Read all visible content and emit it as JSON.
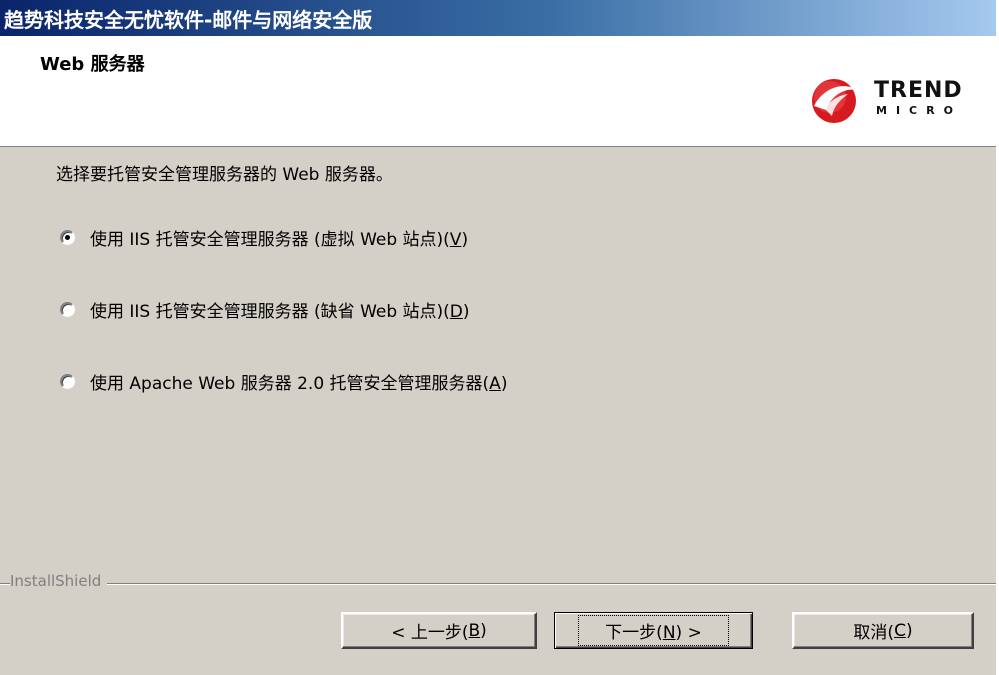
{
  "window": {
    "title": "趋势科技安全无忧软件-邮件与网络安全版"
  },
  "header": {
    "title": "Web 服务器",
    "logo_text": "TREND",
    "logo_sub": "MICRO"
  },
  "main": {
    "instruction": "选择要托管安全管理服务器的 Web 服务器。",
    "options": [
      {
        "label_prefix": "使用 IIS 托管安全管理服务器 (虚拟 Web 站点)(",
        "accel": "V",
        "label_suffix": ")",
        "selected": true
      },
      {
        "label_prefix": "使用 IIS 托管安全管理服务器 (缺省 Web 站点)(",
        "accel": "D",
        "label_suffix": ")",
        "selected": false
      },
      {
        "label_prefix": "使用 Apache Web 服务器 2.0 托管安全管理服务器(",
        "accel": "A",
        "label_suffix": ")",
        "selected": false
      }
    ]
  },
  "footer": {
    "installshield_label": "InstallShield",
    "back": {
      "prefix": "< 上一步(",
      "accel": "B",
      "suffix": ")"
    },
    "next": {
      "prefix": "下一步(",
      "accel": "N",
      "suffix": ") >"
    },
    "cancel": {
      "prefix": "取消(",
      "accel": "C",
      "suffix": ")"
    }
  },
  "colors": {
    "dialog_bg": "#d4d0c8",
    "titlebar_start": "#0a246a",
    "titlebar_end": "#a6caf0",
    "logo_red": "#d71920"
  }
}
